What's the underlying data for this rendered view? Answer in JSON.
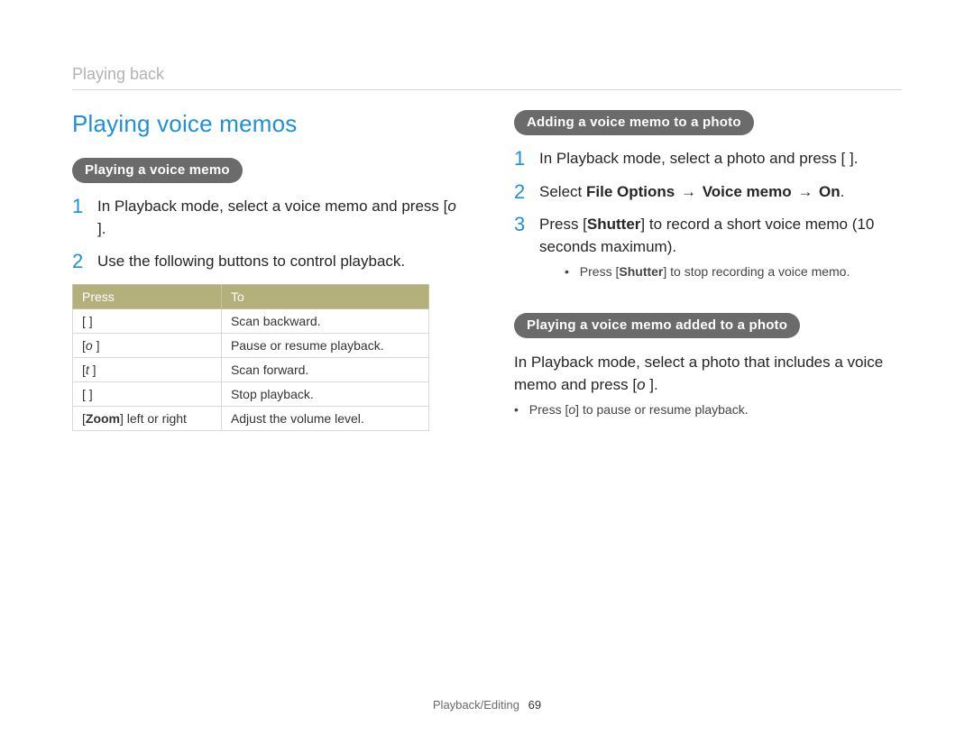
{
  "breadcrumb": "Playing back",
  "footer": {
    "section": "Playback/Editing",
    "page": "69"
  },
  "left": {
    "title": "Playing voice memos",
    "pill": "Playing a voice memo",
    "steps": [
      {
        "num": "1",
        "text": "In Playback mode, select a voice memo and press [",
        "italic": "o",
        "tail": "   ]."
      },
      {
        "num": "2",
        "text": "Use the following buttons to control playback."
      }
    ],
    "table": {
      "headers": [
        "Press",
        "To"
      ],
      "rows": [
        {
          "press": "[   ]",
          "to": "Scan backward."
        },
        {
          "press_pre": "[",
          "press_italic": "o",
          "press_post": "   ]",
          "to": "Pause or resume playback."
        },
        {
          "press_pre": "[",
          "press_italic": "t",
          "press_post": "   ]",
          "to": "Scan forward."
        },
        {
          "press": "[   ]",
          "to": "Stop playback."
        },
        {
          "press_bold_pre": "[",
          "press_bold": "Zoom",
          "press_bold_post": "] left or right",
          "to": "Adjust the volume level."
        }
      ]
    }
  },
  "right": {
    "pill1": "Adding a voice memo to a photo",
    "steps1": [
      {
        "num": "1",
        "text": "In Playback mode, select a photo and press [        ]."
      },
      {
        "num": "2",
        "text_pre": "Select ",
        "bold1": "File Options",
        "arrow1": "→",
        "bold2": "Voice memo",
        "arrow2": "→",
        "bold3": "On",
        "text_post": "."
      },
      {
        "num": "3",
        "text_pre": "Press [",
        "bold1": "Shutter",
        "text_mid": "] to record a short voice memo (10 seconds maximum).",
        "sub": {
          "pre": "Press [",
          "bold": "Shutter",
          "post": "] to stop recording a voice memo."
        }
      }
    ],
    "pill2": "Playing a voice memo added to a photo",
    "para_pre": "In Playback mode, select a photo that includes a voice memo and press [",
    "para_italic": "o",
    "para_post": "   ].",
    "bullet_pre": "Press [",
    "bullet_italic": "o",
    "bullet_post": "] to pause or resume playback."
  }
}
